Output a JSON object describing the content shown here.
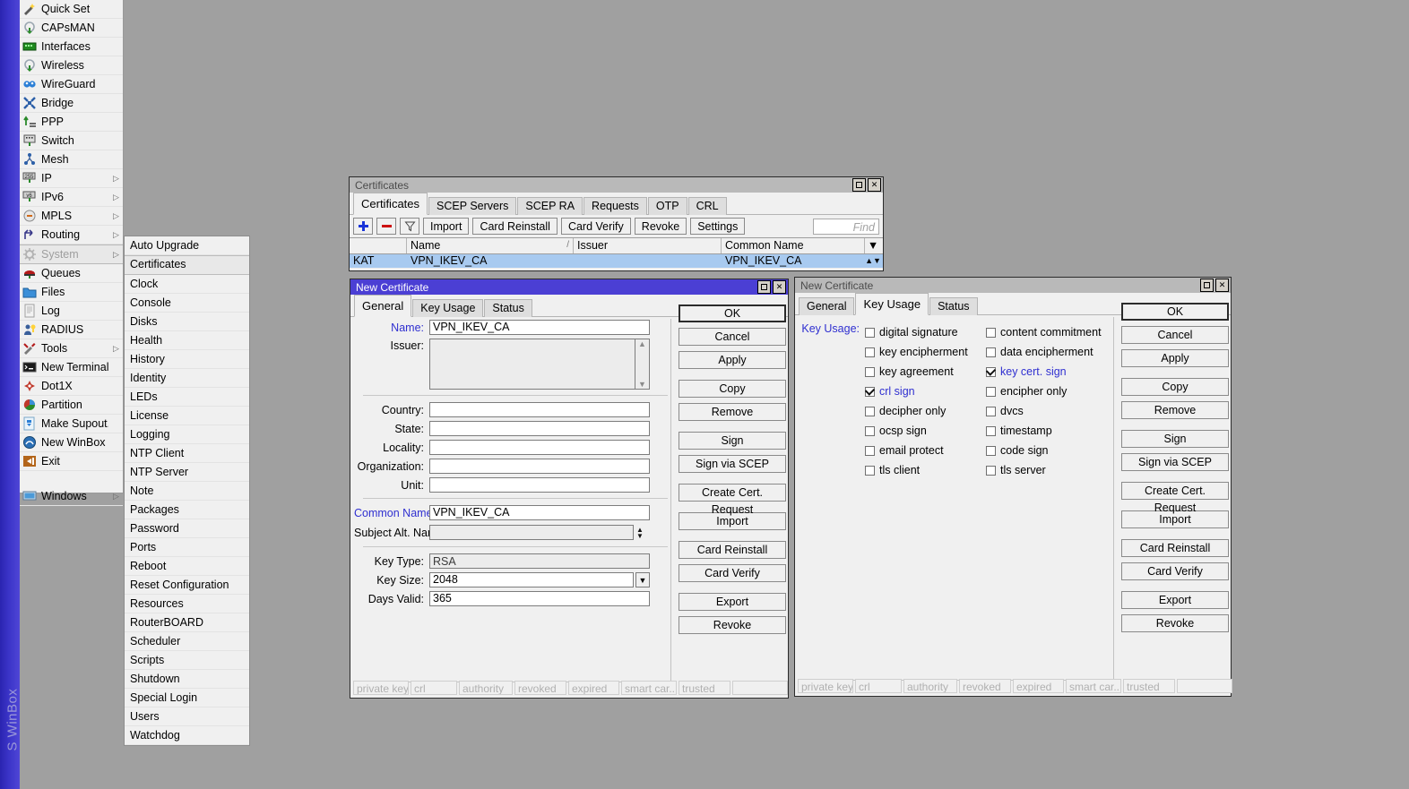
{
  "desktop": {
    "rail_label": "S WinBox",
    "bg_color": "#a0a0a0",
    "accent": "#4b3fd4"
  },
  "mainmenu": {
    "items": [
      {
        "label": "Quick Set",
        "icon": "wand-icon",
        "arrow": false
      },
      {
        "label": "CAPsMAN",
        "icon": "capsman-icon",
        "arrow": false
      },
      {
        "label": "Interfaces",
        "icon": "interfaces-icon",
        "arrow": false
      },
      {
        "label": "Wireless",
        "icon": "wireless-icon",
        "arrow": false
      },
      {
        "label": "WireGuard",
        "icon": "wireguard-icon",
        "arrow": false
      },
      {
        "label": "Bridge",
        "icon": "bridge-icon",
        "arrow": false
      },
      {
        "label": "PPP",
        "icon": "ppp-icon",
        "arrow": false
      },
      {
        "label": "Switch",
        "icon": "switch-icon",
        "arrow": false
      },
      {
        "label": "Mesh",
        "icon": "mesh-icon",
        "arrow": false
      },
      {
        "label": "IP",
        "icon": "ip-icon",
        "arrow": true
      },
      {
        "label": "IPv6",
        "icon": "ipv6-icon",
        "arrow": true
      },
      {
        "label": "MPLS",
        "icon": "mpls-icon",
        "arrow": true
      },
      {
        "label": "Routing",
        "icon": "routing-icon",
        "arrow": true
      },
      {
        "label": "System",
        "icon": "system-icon",
        "arrow": true,
        "selected": true
      },
      {
        "label": "Queues",
        "icon": "queues-icon",
        "arrow": false
      },
      {
        "label": "Files",
        "icon": "files-icon",
        "arrow": false
      },
      {
        "label": "Log",
        "icon": "log-icon",
        "arrow": false
      },
      {
        "label": "RADIUS",
        "icon": "radius-icon",
        "arrow": false
      },
      {
        "label": "Tools",
        "icon": "tools-icon",
        "arrow": true
      },
      {
        "label": "New Terminal",
        "icon": "terminal-icon",
        "arrow": false
      },
      {
        "label": "Dot1X",
        "icon": "dot1x-icon",
        "arrow": false
      },
      {
        "label": "Partition",
        "icon": "partition-icon",
        "arrow": false
      },
      {
        "label": "Make Supout.rif",
        "icon": "supout-icon",
        "arrow": false
      },
      {
        "label": "New WinBox",
        "icon": "winbox-icon",
        "arrow": false
      },
      {
        "label": "Exit",
        "icon": "exit-icon",
        "arrow": false
      },
      {
        "label": "",
        "icon": "",
        "arrow": false,
        "blank": true
      },
      {
        "label": "Windows",
        "icon": "windows-icon",
        "arrow": true
      }
    ]
  },
  "submenu": {
    "items": [
      {
        "label": "Auto Upgrade"
      },
      {
        "label": "Certificates",
        "selected": true
      },
      {
        "label": "Clock"
      },
      {
        "label": "Console"
      },
      {
        "label": "Disks"
      },
      {
        "label": "Health"
      },
      {
        "label": "History"
      },
      {
        "label": "Identity"
      },
      {
        "label": "LEDs"
      },
      {
        "label": "License"
      },
      {
        "label": "Logging"
      },
      {
        "label": "NTP Client"
      },
      {
        "label": "NTP Server"
      },
      {
        "label": "Note"
      },
      {
        "label": "Packages"
      },
      {
        "label": "Password"
      },
      {
        "label": "Ports"
      },
      {
        "label": "Reboot"
      },
      {
        "label": "Reset Configuration"
      },
      {
        "label": "Resources"
      },
      {
        "label": "RouterBOARD"
      },
      {
        "label": "Scheduler"
      },
      {
        "label": "Scripts"
      },
      {
        "label": "Shutdown"
      },
      {
        "label": "Special Login"
      },
      {
        "label": "Users"
      },
      {
        "label": "Watchdog"
      }
    ]
  },
  "certificates_window": {
    "title": "Certificates",
    "active": false,
    "tabs": [
      {
        "label": "Certificates",
        "active": true
      },
      {
        "label": "SCEP Servers",
        "active": false
      },
      {
        "label": "SCEP RA",
        "active": false
      },
      {
        "label": "Requests",
        "active": false
      },
      {
        "label": "OTP",
        "active": false
      },
      {
        "label": "CRL",
        "active": false
      }
    ],
    "toolbar": {
      "add_label": "+",
      "remove_label": "−",
      "filter_label": "filter",
      "buttons": [
        "Import",
        "Card Reinstall",
        "Card Verify",
        "Revoke",
        "Settings"
      ],
      "find_placeholder": "Find"
    },
    "table": {
      "columns": [
        "",
        "Name",
        "Issuer",
        "Common Name"
      ],
      "sort_indicator": "/",
      "rows": [
        {
          "flags": "KAT",
          "name": "VPN_IKEV_CA",
          "issuer": "",
          "common_name": "VPN_IKEV_CA",
          "selected": true
        }
      ]
    }
  },
  "cert_general_dialog": {
    "title": "New Certificate",
    "active": true,
    "tabs": [
      {
        "label": "General",
        "active": true
      },
      {
        "label": "Key Usage",
        "active": false
      },
      {
        "label": "Status",
        "active": false
      }
    ],
    "fields": {
      "name_label": "Name:",
      "name_value": "VPN_IKEV_CA",
      "issuer_label": "Issuer:",
      "issuer_value": "",
      "country_label": "Country:",
      "country_value": "",
      "state_label": "State:",
      "state_value": "",
      "locality_label": "Locality:",
      "locality_value": "",
      "organization_label": "Organization:",
      "organization_value": "",
      "unit_label": "Unit:",
      "unit_value": "",
      "common_name_label": "Common Name:",
      "common_name_value": "VPN_IKEV_CA",
      "subject_alt_name_label": "Subject Alt. Name:",
      "subject_alt_name_value": "",
      "key_type_label": "Key Type:",
      "key_type_value": "RSA",
      "key_size_label": "Key Size:",
      "key_size_value": "2048",
      "days_valid_label": "Days Valid:",
      "days_valid_value": "365"
    },
    "buttons": [
      "OK",
      "Cancel",
      "Apply",
      "Copy",
      "Remove",
      "Sign",
      "Sign via SCEP",
      "Create Cert. Request",
      "Import",
      "Card Reinstall",
      "Card Verify",
      "Export",
      "Revoke"
    ],
    "status_cells": [
      "private key",
      "crl",
      "authority",
      "revoked",
      "expired",
      "smart car...",
      "trusted",
      ""
    ]
  },
  "cert_keyusage_dialog": {
    "title": "New Certificate",
    "active": false,
    "tabs": [
      {
        "label": "General",
        "active": false
      },
      {
        "label": "Key Usage",
        "active": true
      },
      {
        "label": "Status",
        "active": false
      }
    ],
    "key_usage_label": "Key Usage:",
    "checkboxes_left": [
      {
        "label": "digital signature",
        "checked": false
      },
      {
        "label": "key encipherment",
        "checked": false
      },
      {
        "label": "key agreement",
        "checked": false
      },
      {
        "label": "crl sign",
        "checked": true
      },
      {
        "label": "decipher only",
        "checked": false
      },
      {
        "label": "ocsp sign",
        "checked": false
      },
      {
        "label": "email protect",
        "checked": false
      },
      {
        "label": "tls client",
        "checked": false
      }
    ],
    "checkboxes_right": [
      {
        "label": "content commitment",
        "checked": false
      },
      {
        "label": "data encipherment",
        "checked": false
      },
      {
        "label": "key cert. sign",
        "checked": true
      },
      {
        "label": "encipher only",
        "checked": false
      },
      {
        "label": "dvcs",
        "checked": false
      },
      {
        "label": "timestamp",
        "checked": false
      },
      {
        "label": "code sign",
        "checked": false
      },
      {
        "label": "tls server",
        "checked": false
      }
    ],
    "buttons": [
      "OK",
      "Cancel",
      "Apply",
      "Copy",
      "Remove",
      "Sign",
      "Sign via SCEP",
      "Create Cert. Request",
      "Import",
      "Card Reinstall",
      "Card Verify",
      "Export",
      "Revoke"
    ],
    "status_cells": [
      "private key",
      "crl",
      "authority",
      "revoked",
      "expired",
      "smart car...",
      "trusted",
      ""
    ]
  }
}
